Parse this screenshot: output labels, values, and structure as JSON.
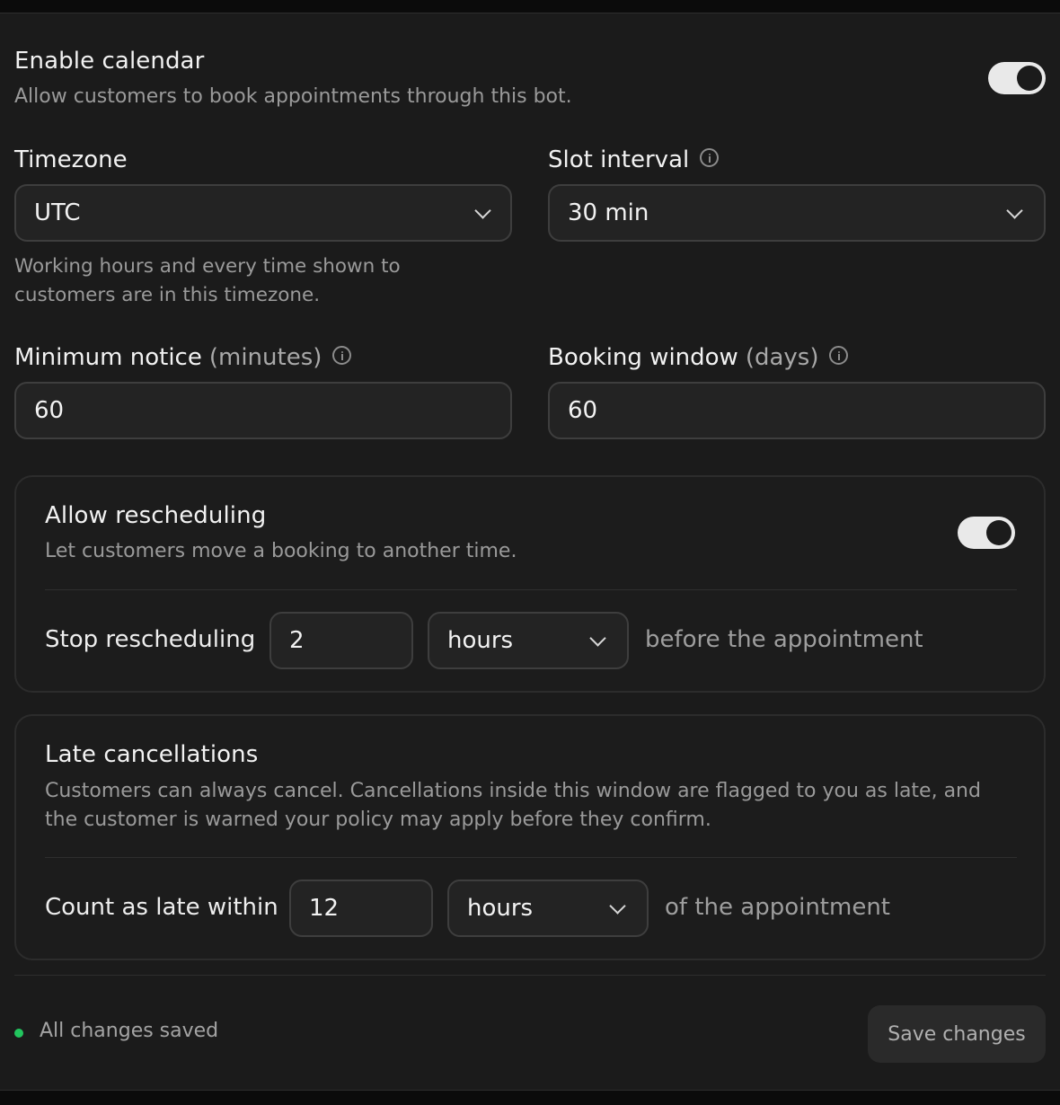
{
  "calendar": {
    "title": "Enable calendar",
    "subtitle": "Allow customers to book appointments through this bot.",
    "enabled": true
  },
  "timezone": {
    "label": "Timezone",
    "value": "UTC",
    "help": "Working hours and every time shown to customers are in this timezone."
  },
  "slot_interval": {
    "label": "Slot interval",
    "value": "30 min"
  },
  "minimum_notice": {
    "label": "Minimum notice",
    "unit": "(minutes)",
    "value": "60"
  },
  "booking_window": {
    "label": "Booking window",
    "unit": "(days)",
    "value": "60"
  },
  "rescheduling": {
    "title": "Allow rescheduling",
    "subtitle": "Let customers move a booking to another time.",
    "enabled": true,
    "stop_label": "Stop rescheduling",
    "stop_value": "2",
    "stop_unit": "hours",
    "stop_suffix": "before the appointment"
  },
  "late_cancellations": {
    "title": "Late cancellations",
    "description": "Customers can always cancel. Cancellations inside this window are flagged to you as late, and the customer is warned your policy may apply before they confirm.",
    "count_label": "Count as late within",
    "count_value": "12",
    "count_unit": "hours",
    "count_suffix": "of the appointment"
  },
  "footer": {
    "status": "All changes saved",
    "status_color": "#22c55e",
    "save_label": "Save changes"
  }
}
